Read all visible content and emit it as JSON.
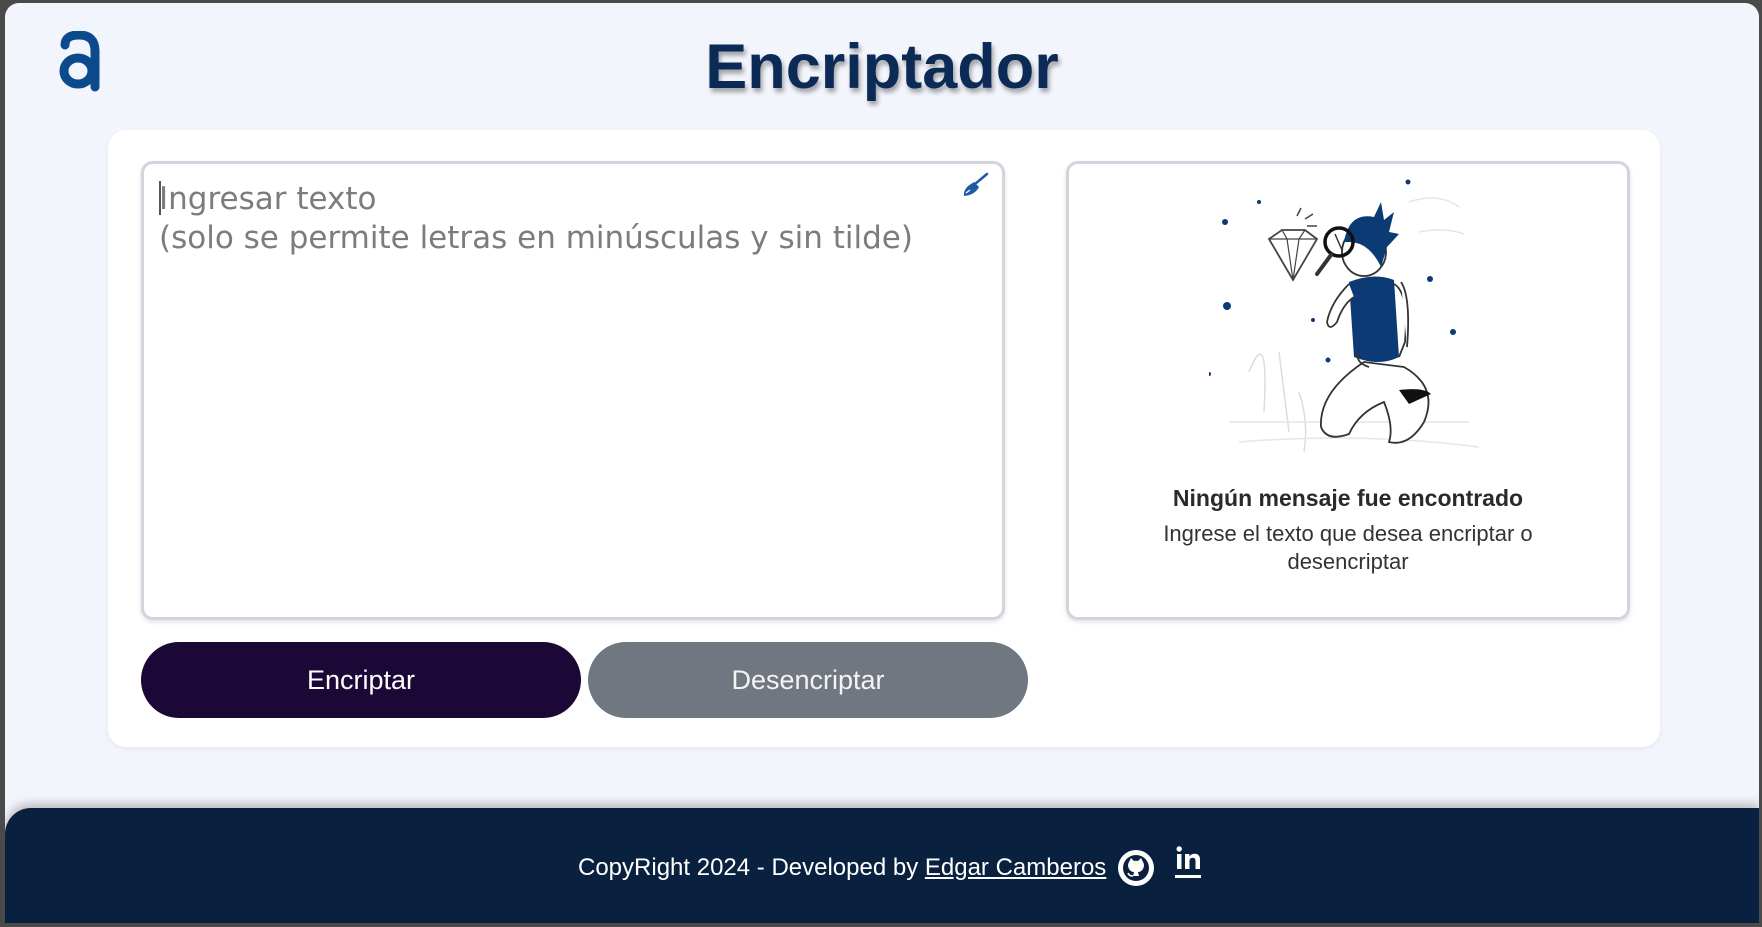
{
  "app": {
    "title": "Encriptador",
    "logo_icon": "alura-a-logo-icon",
    "accent_color": "#0b2a55"
  },
  "input": {
    "placeholder": "Ingresar texto\n(solo se permite letras en minúsculas y sin tilde)",
    "value": "",
    "clear_icon": "broom-icon"
  },
  "result": {
    "illustration": "person-with-magnifying-glass-illustration",
    "title": "Ningún mensaje fue encontrado",
    "subtitle": "Ingrese el texto que desea encriptar o desencriptar"
  },
  "buttons": {
    "encrypt_label": "Encriptar",
    "encrypt_color": "#1c0836",
    "decrypt_label": "Desencriptar",
    "decrypt_color": "#717780"
  },
  "footer": {
    "text": "CopyRight 2024 - Developed by ",
    "author": "Edgar Camberos",
    "github_icon": "github-icon",
    "linkedin_icon": "linkedin-icon",
    "background": "#0a203f"
  }
}
